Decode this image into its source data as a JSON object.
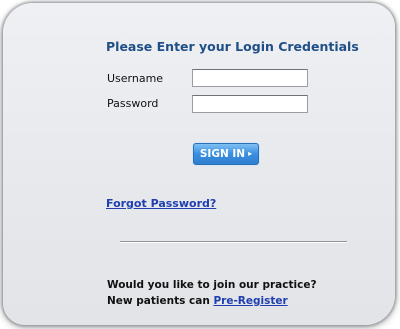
{
  "login": {
    "title": "Please Enter your Login Credentials",
    "username_label": "Username",
    "username_value": "",
    "password_label": "Password",
    "password_value": "",
    "signin_label": "SIGN IN",
    "signin_arrow": "▸",
    "forgot_label": "Forgot Password?"
  },
  "register": {
    "question": "Would you like to join our practice?",
    "prefix": "New patients can",
    "link_label": "Pre-Register"
  },
  "colors": {
    "title": "#1f4f86",
    "button": "#3a8fe0",
    "link": "#1f3fb0"
  }
}
